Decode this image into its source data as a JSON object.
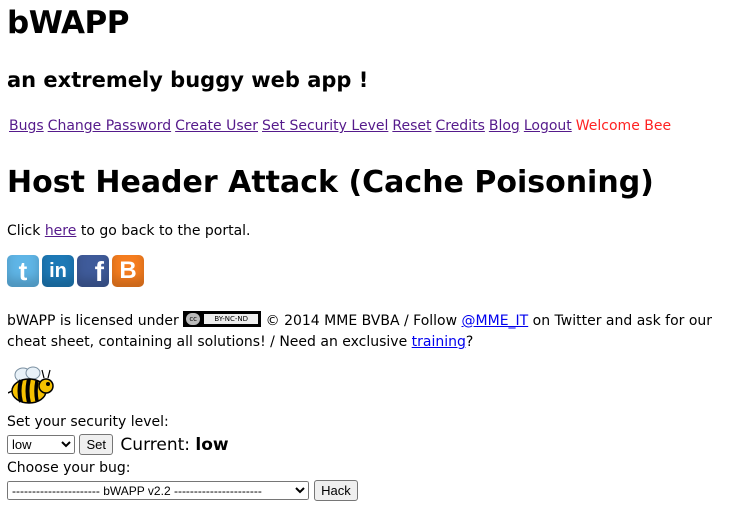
{
  "app": {
    "title": "bWAPP",
    "subtitle": "an extremely buggy web app !"
  },
  "nav": {
    "items": [
      {
        "label": "Bugs"
      },
      {
        "label": "Change Password"
      },
      {
        "label": "Create User"
      },
      {
        "label": "Set Security Level"
      },
      {
        "label": "Reset"
      },
      {
        "label": "Credits"
      },
      {
        "label": "Blog"
      },
      {
        "label": "Logout"
      }
    ],
    "welcome": "Welcome Bee"
  },
  "page": {
    "title": "Host Header Attack (Cache Poisoning)",
    "back_prefix": "Click",
    "back_link": "here",
    "back_suffix": "to go back to the portal."
  },
  "social": [
    {
      "name": "twitter-icon",
      "glyph": "t"
    },
    {
      "name": "linkedin-icon",
      "glyph": "in"
    },
    {
      "name": "facebook-icon",
      "glyph": "f"
    },
    {
      "name": "blogger-icon",
      "glyph": "B"
    }
  ],
  "license": {
    "prefix": "bWAPP is licensed under",
    "badge_left": "cc",
    "badge_right": "BY-NC-ND",
    "copyright": "© 2014 MME BVBA / Follow",
    "twitter_link": "@MME_IT",
    "mid": "on Twitter and ask for our cheat sheet, containing all solutions! / Need an exclusive",
    "training_link": "training",
    "end": "?"
  },
  "security": {
    "label": "Set your security level:",
    "selected": "low",
    "set_button": "Set",
    "current_label": "Current:",
    "current_value": "low"
  },
  "bug": {
    "label": "Choose your bug:",
    "selected": "---------------------- bWAPP v2.2 ----------------------",
    "hack_button": "Hack"
  },
  "colors": {
    "visited_link": "#551a8b",
    "link": "#0000ee",
    "welcome": "#ff2222"
  }
}
